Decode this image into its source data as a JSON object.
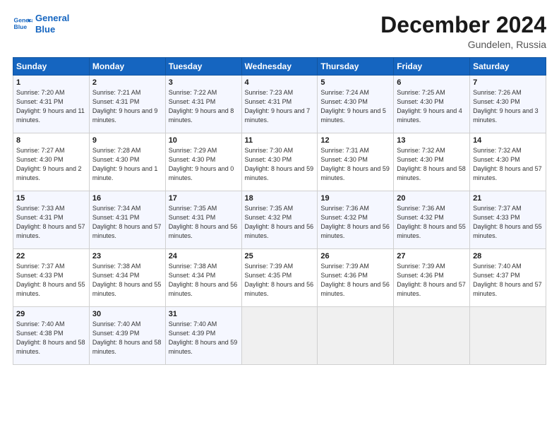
{
  "header": {
    "logo_line1": "General",
    "logo_line2": "Blue",
    "title": "December 2024",
    "subtitle": "Gundelen, Russia"
  },
  "weekdays": [
    "Sunday",
    "Monday",
    "Tuesday",
    "Wednesday",
    "Thursday",
    "Friday",
    "Saturday"
  ],
  "weeks": [
    [
      {
        "day": "1",
        "sunrise": "Sunrise: 7:20 AM",
        "sunset": "Sunset: 4:31 PM",
        "daylight": "Daylight: 9 hours and 11 minutes."
      },
      {
        "day": "2",
        "sunrise": "Sunrise: 7:21 AM",
        "sunset": "Sunset: 4:31 PM",
        "daylight": "Daylight: 9 hours and 9 minutes."
      },
      {
        "day": "3",
        "sunrise": "Sunrise: 7:22 AM",
        "sunset": "Sunset: 4:31 PM",
        "daylight": "Daylight: 9 hours and 8 minutes."
      },
      {
        "day": "4",
        "sunrise": "Sunrise: 7:23 AM",
        "sunset": "Sunset: 4:31 PM",
        "daylight": "Daylight: 9 hours and 7 minutes."
      },
      {
        "day": "5",
        "sunrise": "Sunrise: 7:24 AM",
        "sunset": "Sunset: 4:30 PM",
        "daylight": "Daylight: 9 hours and 5 minutes."
      },
      {
        "day": "6",
        "sunrise": "Sunrise: 7:25 AM",
        "sunset": "Sunset: 4:30 PM",
        "daylight": "Daylight: 9 hours and 4 minutes."
      },
      {
        "day": "7",
        "sunrise": "Sunrise: 7:26 AM",
        "sunset": "Sunset: 4:30 PM",
        "daylight": "Daylight: 9 hours and 3 minutes."
      }
    ],
    [
      {
        "day": "8",
        "sunrise": "Sunrise: 7:27 AM",
        "sunset": "Sunset: 4:30 PM",
        "daylight": "Daylight: 9 hours and 2 minutes."
      },
      {
        "day": "9",
        "sunrise": "Sunrise: 7:28 AM",
        "sunset": "Sunset: 4:30 PM",
        "daylight": "Daylight: 9 hours and 1 minute."
      },
      {
        "day": "10",
        "sunrise": "Sunrise: 7:29 AM",
        "sunset": "Sunset: 4:30 PM",
        "daylight": "Daylight: 9 hours and 0 minutes."
      },
      {
        "day": "11",
        "sunrise": "Sunrise: 7:30 AM",
        "sunset": "Sunset: 4:30 PM",
        "daylight": "Daylight: 8 hours and 59 minutes."
      },
      {
        "day": "12",
        "sunrise": "Sunrise: 7:31 AM",
        "sunset": "Sunset: 4:30 PM",
        "daylight": "Daylight: 8 hours and 59 minutes."
      },
      {
        "day": "13",
        "sunrise": "Sunrise: 7:32 AM",
        "sunset": "Sunset: 4:30 PM",
        "daylight": "Daylight: 8 hours and 58 minutes."
      },
      {
        "day": "14",
        "sunrise": "Sunrise: 7:32 AM",
        "sunset": "Sunset: 4:30 PM",
        "daylight": "Daylight: 8 hours and 57 minutes."
      }
    ],
    [
      {
        "day": "15",
        "sunrise": "Sunrise: 7:33 AM",
        "sunset": "Sunset: 4:31 PM",
        "daylight": "Daylight: 8 hours and 57 minutes."
      },
      {
        "day": "16",
        "sunrise": "Sunrise: 7:34 AM",
        "sunset": "Sunset: 4:31 PM",
        "daylight": "Daylight: 8 hours and 57 minutes."
      },
      {
        "day": "17",
        "sunrise": "Sunrise: 7:35 AM",
        "sunset": "Sunset: 4:31 PM",
        "daylight": "Daylight: 8 hours and 56 minutes."
      },
      {
        "day": "18",
        "sunrise": "Sunrise: 7:35 AM",
        "sunset": "Sunset: 4:32 PM",
        "daylight": "Daylight: 8 hours and 56 minutes."
      },
      {
        "day": "19",
        "sunrise": "Sunrise: 7:36 AM",
        "sunset": "Sunset: 4:32 PM",
        "daylight": "Daylight: 8 hours and 56 minutes."
      },
      {
        "day": "20",
        "sunrise": "Sunrise: 7:36 AM",
        "sunset": "Sunset: 4:32 PM",
        "daylight": "Daylight: 8 hours and 55 minutes."
      },
      {
        "day": "21",
        "sunrise": "Sunrise: 7:37 AM",
        "sunset": "Sunset: 4:33 PM",
        "daylight": "Daylight: 8 hours and 55 minutes."
      }
    ],
    [
      {
        "day": "22",
        "sunrise": "Sunrise: 7:37 AM",
        "sunset": "Sunset: 4:33 PM",
        "daylight": "Daylight: 8 hours and 55 minutes."
      },
      {
        "day": "23",
        "sunrise": "Sunrise: 7:38 AM",
        "sunset": "Sunset: 4:34 PM",
        "daylight": "Daylight: 8 hours and 55 minutes."
      },
      {
        "day": "24",
        "sunrise": "Sunrise: 7:38 AM",
        "sunset": "Sunset: 4:34 PM",
        "daylight": "Daylight: 8 hours and 56 minutes."
      },
      {
        "day": "25",
        "sunrise": "Sunrise: 7:39 AM",
        "sunset": "Sunset: 4:35 PM",
        "daylight": "Daylight: 8 hours and 56 minutes."
      },
      {
        "day": "26",
        "sunrise": "Sunrise: 7:39 AM",
        "sunset": "Sunset: 4:36 PM",
        "daylight": "Daylight: 8 hours and 56 minutes."
      },
      {
        "day": "27",
        "sunrise": "Sunrise: 7:39 AM",
        "sunset": "Sunset: 4:36 PM",
        "daylight": "Daylight: 8 hours and 57 minutes."
      },
      {
        "day": "28",
        "sunrise": "Sunrise: 7:40 AM",
        "sunset": "Sunset: 4:37 PM",
        "daylight": "Daylight: 8 hours and 57 minutes."
      }
    ],
    [
      {
        "day": "29",
        "sunrise": "Sunrise: 7:40 AM",
        "sunset": "Sunset: 4:38 PM",
        "daylight": "Daylight: 8 hours and 58 minutes."
      },
      {
        "day": "30",
        "sunrise": "Sunrise: 7:40 AM",
        "sunset": "Sunset: 4:39 PM",
        "daylight": "Daylight: 8 hours and 58 minutes."
      },
      {
        "day": "31",
        "sunrise": "Sunrise: 7:40 AM",
        "sunset": "Sunset: 4:39 PM",
        "daylight": "Daylight: 8 hours and 59 minutes."
      },
      null,
      null,
      null,
      null
    ]
  ]
}
